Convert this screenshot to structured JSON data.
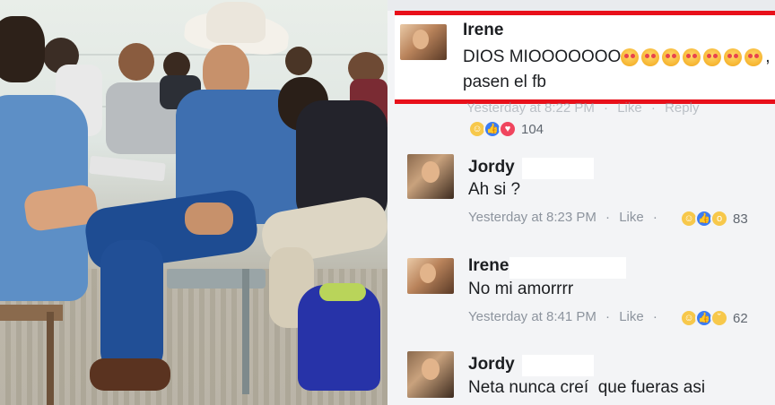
{
  "comments": [
    {
      "author": "Irene",
      "text": "DIOS MIOOOOOOO",
      "text_tail": ",",
      "text_line2": "pasen el fb",
      "emoji_count": 7,
      "emoji_icon": "heart-eyes-emoji-icon",
      "meta": "Yesterday at 8:22 PM",
      "like_label": "Like",
      "reply_label": "Reply",
      "reactions": [
        "haha",
        "like",
        "love"
      ],
      "reaction_count": "104"
    },
    {
      "author": "Jordy",
      "text": "Ah si ?",
      "meta": "Yesterday at 8:23 PM",
      "like_label": "Like",
      "reactions": [
        "haha",
        "like",
        "wow"
      ],
      "reaction_count": "83"
    },
    {
      "author": "Irene",
      "text": "No mi amorrrr",
      "meta": "Yesterday at 8:41 PM",
      "like_label": "Like",
      "reactions": [
        "haha",
        "like",
        "sad"
      ],
      "reaction_count": "62"
    },
    {
      "author": "Jordy",
      "text": "Neta nunca creí  que fueras asi"
    }
  ],
  "colors": {
    "highlight_border": "#e8101a",
    "panel_bg": "#f3f4f6",
    "meta_text": "#8d949e",
    "like_reaction": "#3b7cf4",
    "love_reaction": "#f0455e",
    "haha_reaction": "#f7c84b"
  }
}
